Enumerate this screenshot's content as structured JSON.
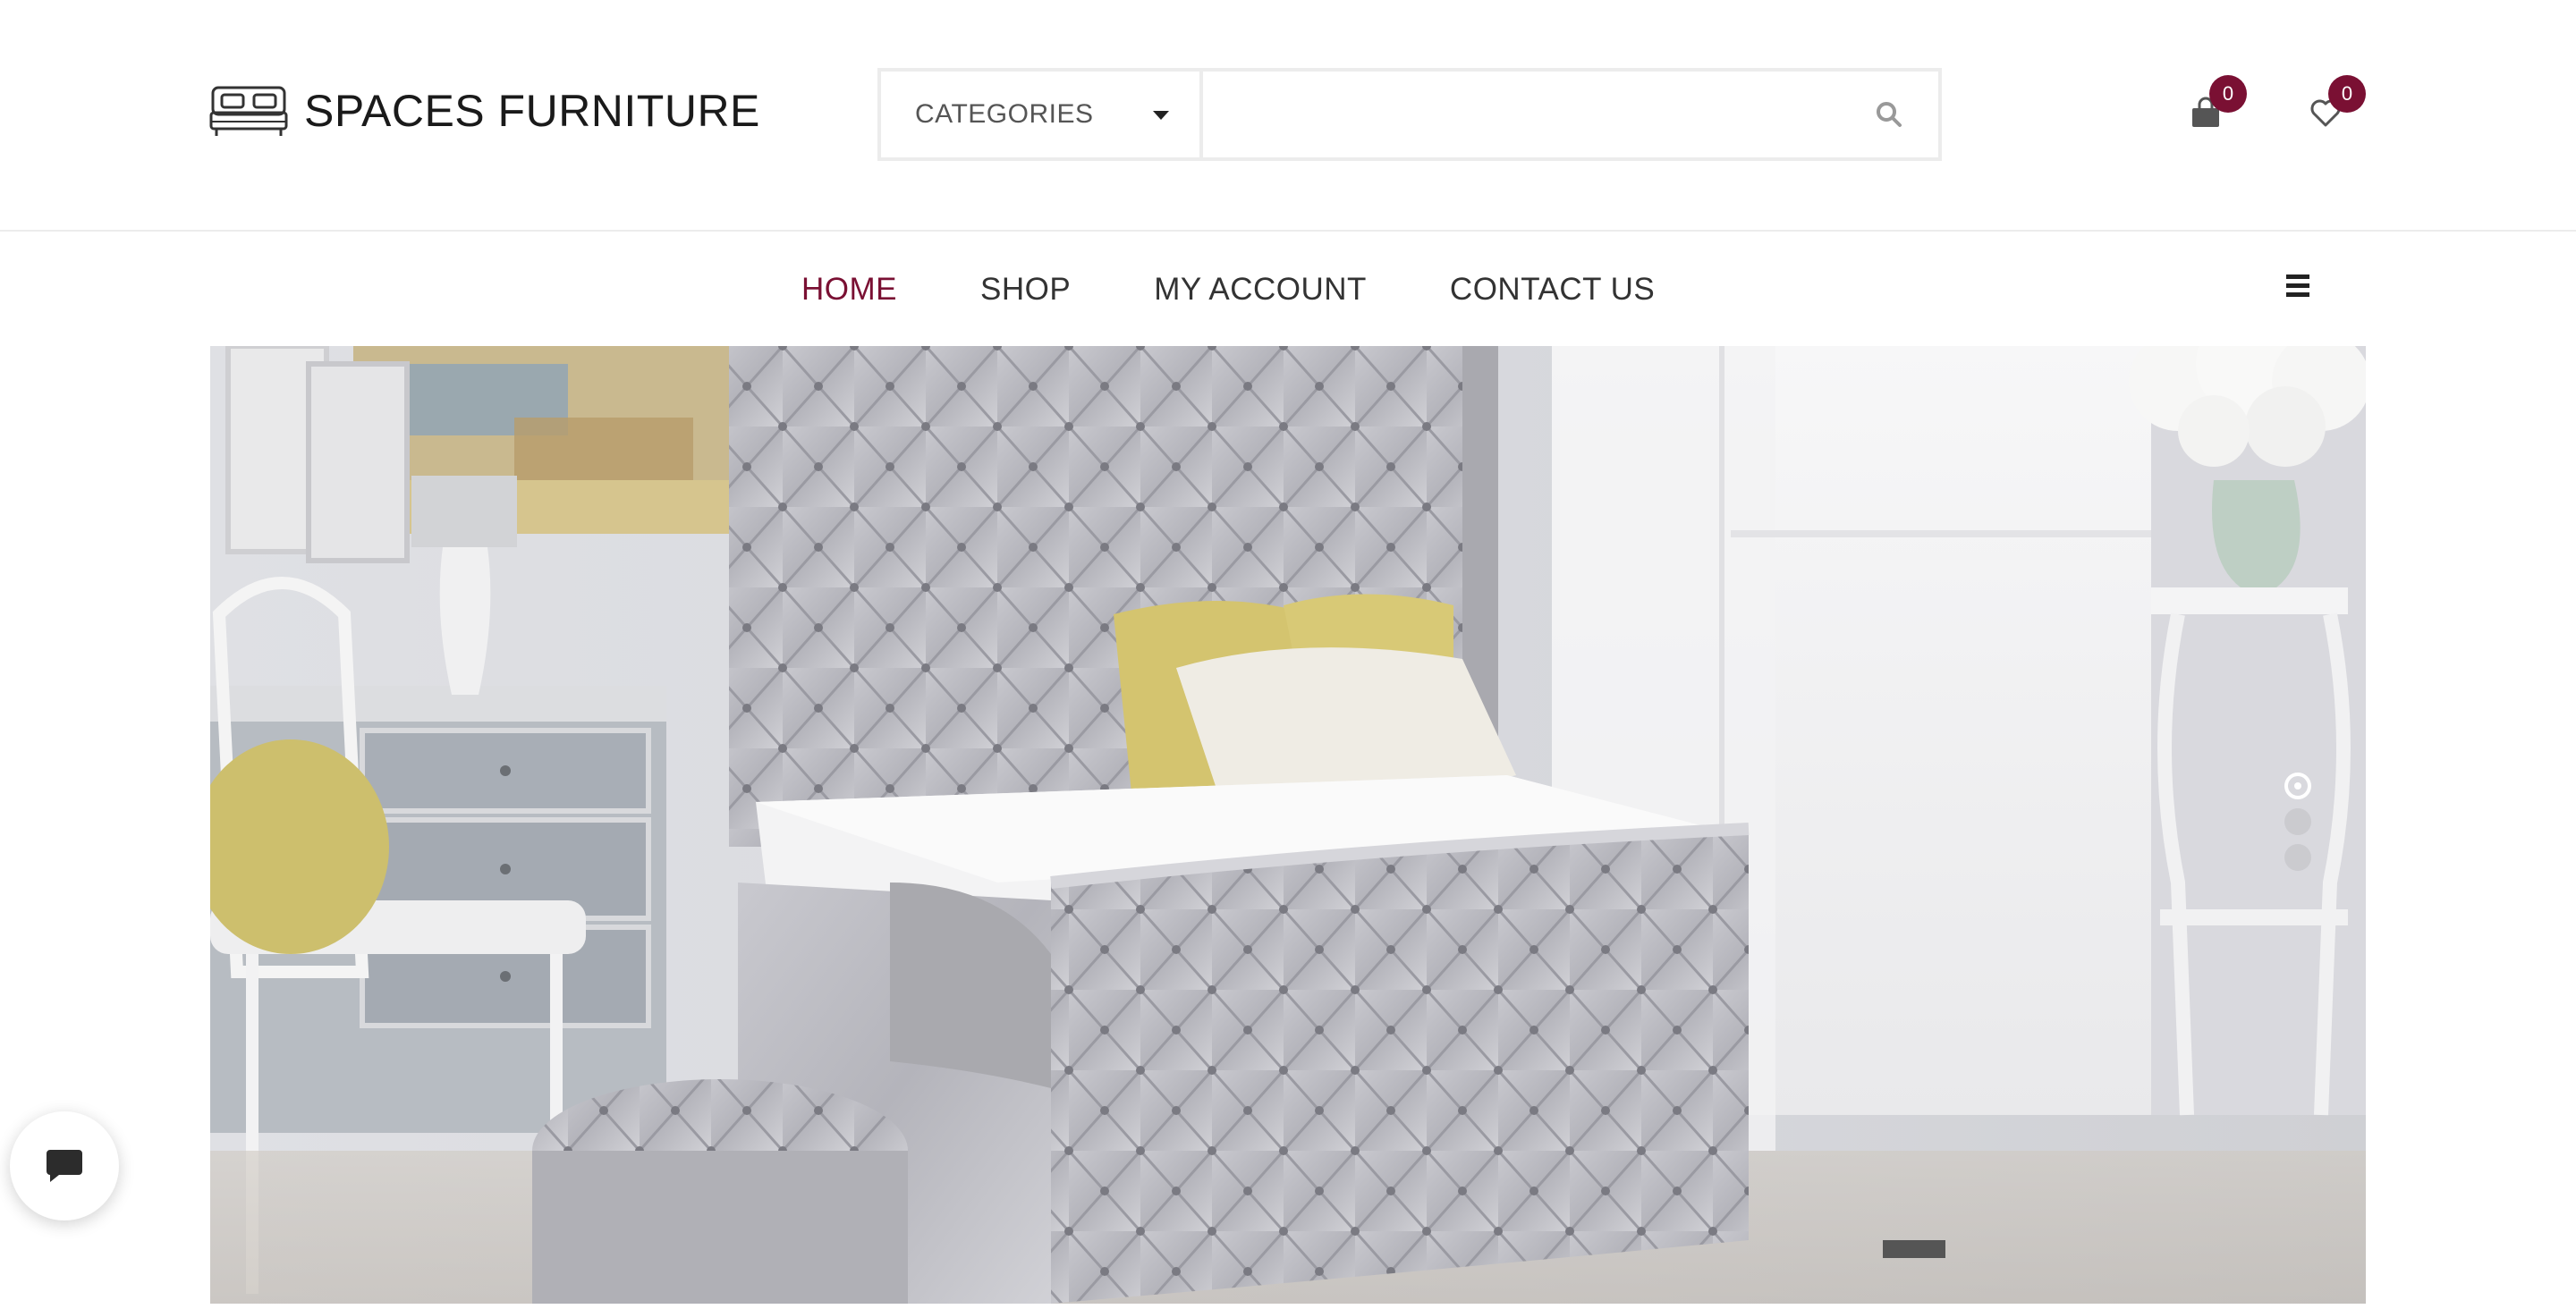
{
  "brand": {
    "name": "SPACES FURNITURE",
    "logo_icon": "bed-icon"
  },
  "search": {
    "category_label": "CATEGORIES",
    "value": "",
    "placeholder": "",
    "icon": "search-icon"
  },
  "header_icons": {
    "cart": {
      "icon": "shopping-bag-icon",
      "count": "0"
    },
    "wishlist": {
      "icon": "heart-icon",
      "count": "0"
    }
  },
  "nav": {
    "items": [
      {
        "label": "HOME",
        "active": true
      },
      {
        "label": "SHOP",
        "active": false
      },
      {
        "label": "MY ACCOUNT",
        "active": false
      },
      {
        "label": "CONTACT US",
        "active": false
      }
    ],
    "menu_icon": "hamburger-icon"
  },
  "hero": {
    "image": "tufted-silver-velvet-bed-photo",
    "slides_total": 3,
    "active_slide": 1
  },
  "chat": {
    "icon": "chat-bubble-icon"
  },
  "colors": {
    "accent": "#7a1033",
    "text": "#333333",
    "border": "#ececec"
  }
}
